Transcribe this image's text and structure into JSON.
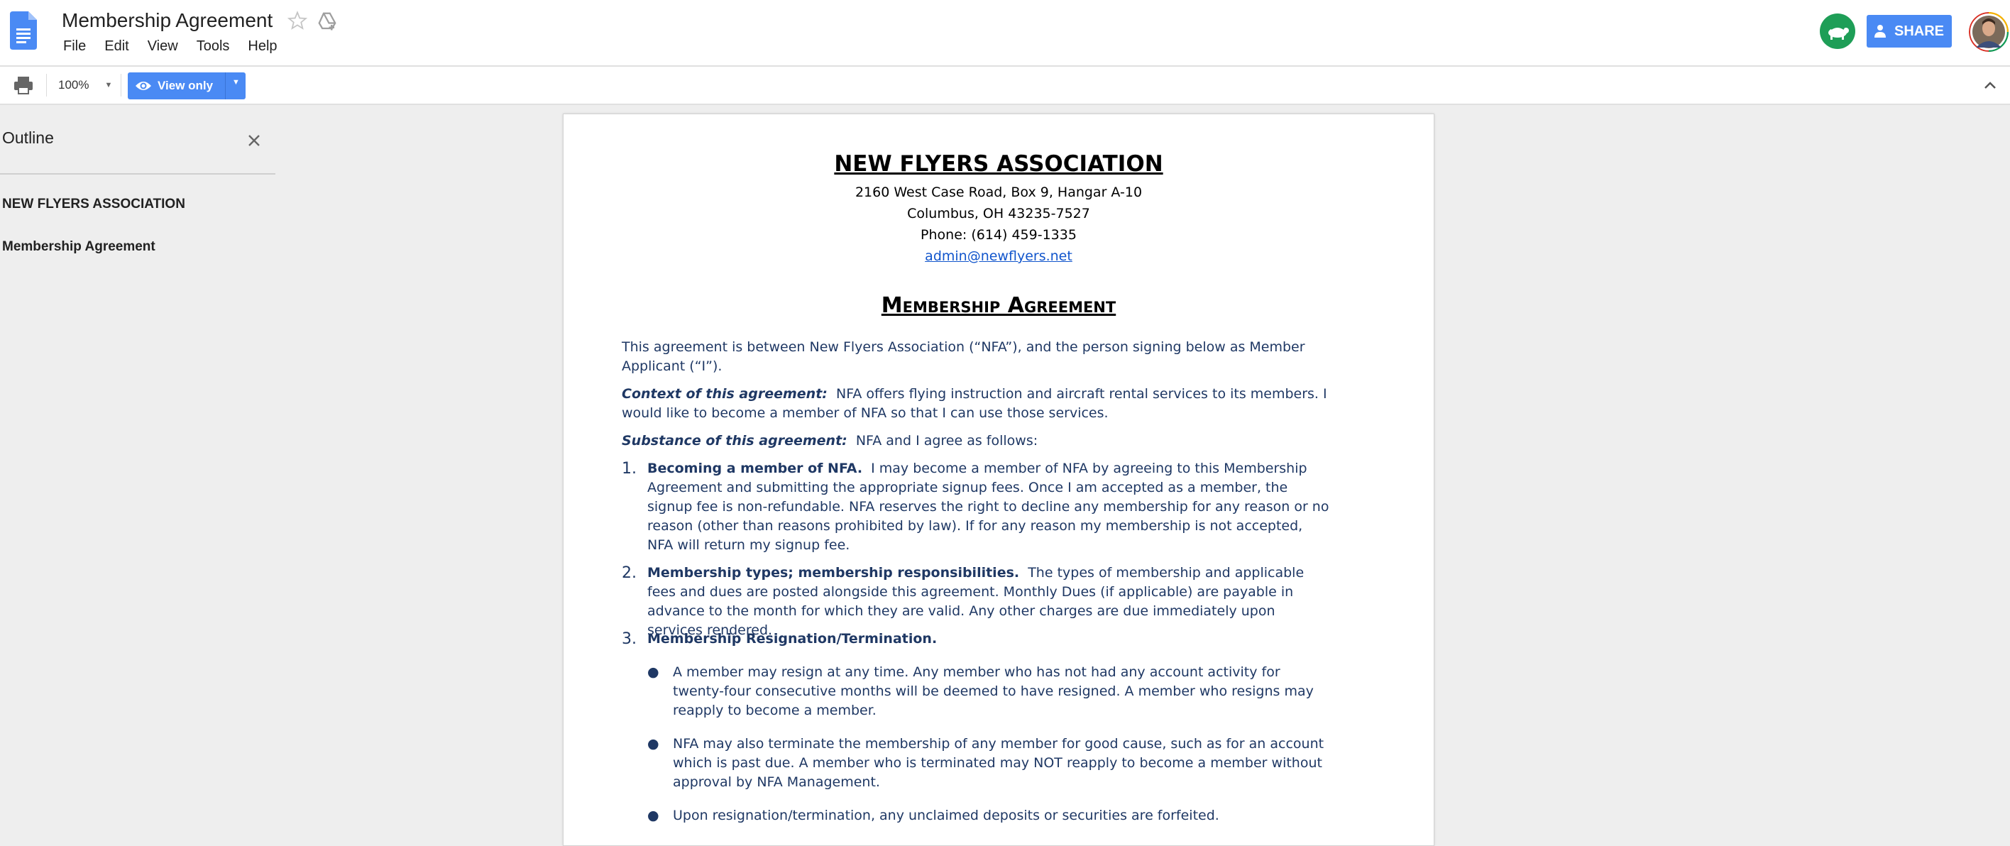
{
  "header": {
    "doc_title": "Membership Agreement",
    "menu": [
      "File",
      "Edit",
      "View",
      "Tools",
      "Help"
    ],
    "share_label": "SHARE"
  },
  "toolbar": {
    "zoom": "100%",
    "mode_label": "View only"
  },
  "outline": {
    "heading": "Outline",
    "items": [
      "NEW FLYERS ASSOCIATION",
      "Membership Agreement"
    ]
  },
  "document": {
    "org_name": "NEW FLYERS ASSOCIATION",
    "address_line_1": "2160 West Case Road,  Box 9, Hangar A-10",
    "address_line_2": "Columbus, OH 43235-7527",
    "phone": "Phone:  (614) 459-1335",
    "email": "admin@newflyers.net",
    "title": "Membership Agreement",
    "intro": "This agreement is between New Flyers Association (“NFA”), and the person signing below as Member Applicant (“I”).",
    "context_label": "Context of this agreement:",
    "context_text": "NFA offers flying instruction and aircraft rental services to its members.  I would like to become a member of NFA so that I can use those services.",
    "substance_label": "Substance of this agreement:",
    "substance_text": "NFA and I agree as follows:",
    "sections": [
      {
        "number": "1.",
        "heading": "Becoming a member of NFA.",
        "text": "I may become a member of NFA by agreeing to this Membership Agreement and submitting the appropriate signup fees.   Once I am accepted as a member, the signup fee is non-refundable.  NFA reserves the right to decline any membership for any reason or no reason (other than reasons prohibited by law).  If for any reason my membership is not accepted, NFA will return my signup fee."
      },
      {
        "number": "2.",
        "heading": "Membership types; membership responsibilities.",
        "text": "The types of membership and applicable fees and dues are posted alongside this agreement.  Monthly Dues (if applicable) are payable in advance to the month for which they are valid.  Any other charges are due immediately upon services rendered."
      },
      {
        "number": "3.",
        "heading": "Membership Resignation/Termination.",
        "text": ""
      }
    ],
    "bullets": [
      "A member may resign at any time. Any member who has not had any account activity for twenty-four consecutive months will be deemed to have resigned. A member who resigns may reapply to become a member.",
      "NFA may also terminate the membership of any member for good cause, such as for an account which is past due.  A member who is terminated may NOT reapply to become a member without approval by NFA Management.",
      "Upon resignation/termination, any unclaimed deposits or securities are forfeited."
    ]
  },
  "colors": {
    "accent_blue": "#4a8af4",
    "doc_text": "#1f3864",
    "link": "#1155cc",
    "presence_green": "#1e9e57"
  },
  "icons": [
    "docs-logo-icon",
    "star-icon",
    "drive-icon",
    "print-icon",
    "eye-icon",
    "close-icon",
    "chevron-up-icon",
    "person-icon"
  ]
}
